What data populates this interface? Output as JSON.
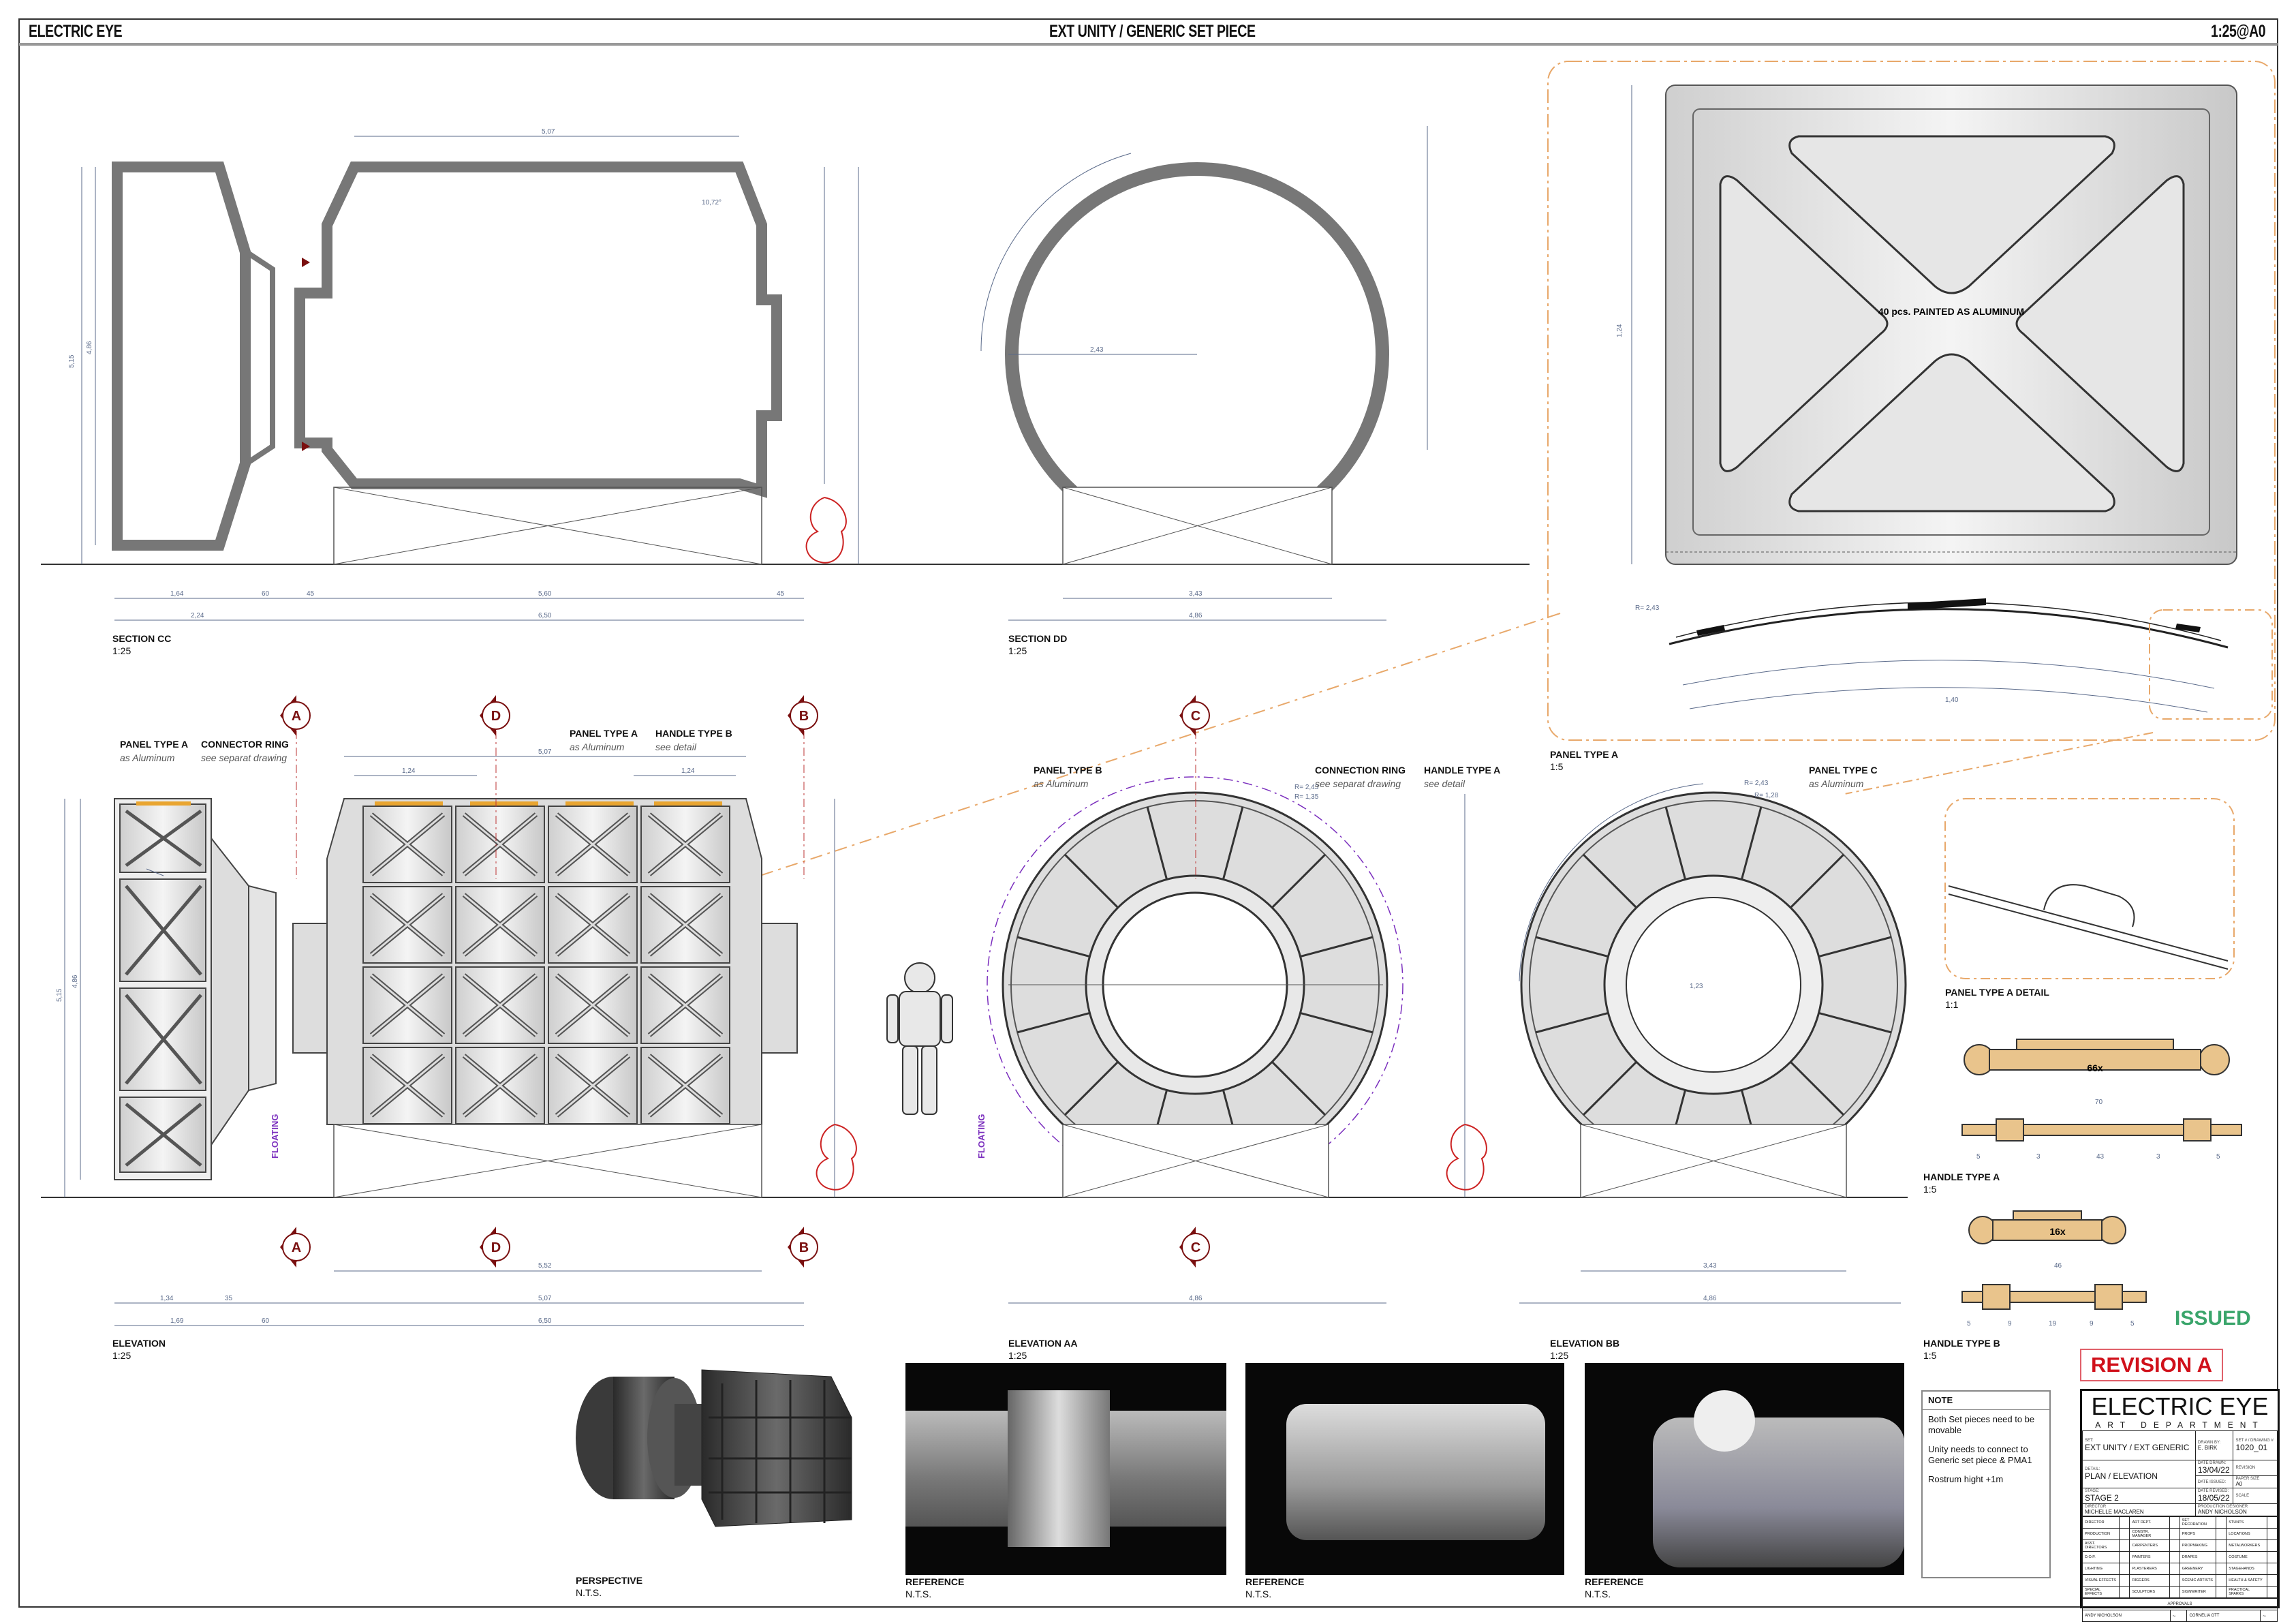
{
  "header": {
    "left": "ELECTRIC EYE",
    "center": "EXT UNITY / GENERIC SET PIECE",
    "right": "1:25@A0"
  },
  "views": {
    "section_cc": {
      "title": "SECTION CC",
      "scale": "1:25"
    },
    "section_dd": {
      "title": "SECTION DD",
      "scale": "1:25"
    },
    "elevation": {
      "title": "ELEVATION",
      "scale": "1:25"
    },
    "elevation_aa": {
      "title": "ELEVATION AA",
      "scale": "1:25"
    },
    "elevation_bb": {
      "title": "ELEVATION BB",
      "scale": "1:25"
    },
    "panel_a": {
      "title": "PANEL TYPE A",
      "scale": "1:5",
      "note": "40 pcs. PAINTED AS ALUMINUM"
    },
    "panel_a_detail": {
      "title": "PANEL TYPE A DETAIL",
      "scale": "1:1"
    },
    "handle_a": {
      "title": "HANDLE TYPE A",
      "scale": "1:5",
      "count": "66x"
    },
    "handle_b": {
      "title": "HANDLE TYPE B",
      "scale": "1:5",
      "count": "16x"
    },
    "perspective": {
      "title": "PERSPECTIVE",
      "scale": "N.T.S."
    },
    "references": [
      {
        "title": "REFERENCE",
        "scale": "N.T.S."
      },
      {
        "title": "REFERENCE",
        "scale": "N.T.S."
      },
      {
        "title": "REFERENCE",
        "scale": "N.T.S."
      }
    ]
  },
  "callouts": {
    "panel_a_1": {
      "title": "PANEL TYPE A",
      "sub": "as Aluminum"
    },
    "connector_ring": {
      "title": "CONNECTOR RING",
      "sub": "see separat drawing"
    },
    "panel_a_2": {
      "title": "PANEL TYPE A",
      "sub": "as Aluminum"
    },
    "handle_b": {
      "title": "HANDLE TYPE B",
      "sub": "see detail"
    },
    "panel_b": {
      "title": "PANEL TYPE B",
      "sub": "as Aluminum"
    },
    "connection_ring": {
      "title": "CONNECTION RING",
      "sub": "see separat drawing"
    },
    "handle_a": {
      "title": "HANDLE TYPE A",
      "sub": "see detail"
    },
    "panel_c": {
      "title": "PANEL TYPE C",
      "sub": "as Aluminum"
    },
    "floating": "FLOATING"
  },
  "markers": [
    "A",
    "D",
    "B",
    "C"
  ],
  "dims": {
    "cc_top": "5,07",
    "cc_a": "1,64",
    "cc_b": "60",
    "cc_c": "45",
    "cc_d": "5,60",
    "cc_e": "45",
    "cc_total_l": "2,24",
    "cc_total": "6,50",
    "cc_h": "5,15",
    "cc_h2": "4,86",
    "cc_angle": "10,72°",
    "dd_r": "2,43",
    "dd_w": "3,43",
    "dd_w2": "4,86",
    "el_top": "5,07",
    "el_p": "1,24",
    "el_p2": "1,24",
    "el_h": "5,15",
    "el_h2": "4,86",
    "el_a": "1,34",
    "el_b": "35",
    "el_c": "5,07",
    "el_total_l": "1,69",
    "el_total_m": "60",
    "el_total": "6,50",
    "el_span": "5,52",
    "aa_w": "4,86",
    "aa_r1": "R= 2,43",
    "aa_r2": "R= 1,35",
    "bb_w": "3,43",
    "bb_w2": "4,86",
    "bb_r1": "R= 2,43",
    "bb_r2": "R= 1,28",
    "bb_i": "1,23",
    "ha_len": "70",
    "ha_seg": [
      "5",
      "3",
      "43",
      "3",
      "5"
    ],
    "hb_len": "46",
    "hb_seg": [
      "5",
      "9",
      "19",
      "9",
      "5"
    ],
    "pa_w": "1,40",
    "pa_r": "R= 2,43",
    "pa_h": "1,24"
  },
  "stamps": {
    "issued": "ISSUED",
    "revision": "REVISION A",
    "issued_color": "#3aa56b",
    "revision_color": "#d0101a"
  },
  "note": {
    "title": "NOTE",
    "lines": [
      "Both Set pieces need to be movable",
      "Unity needs to connect to Generic set piece & PMA1",
      "Rostrum hight +1m"
    ]
  },
  "title_block": {
    "company": "ELECTRIC EYE",
    "dept": "ART DEPARTMENT",
    "set_label": "SET:",
    "set": "EXT UNITY / EXT GENERIC",
    "drawn_by_label": "DRAWN BY:",
    "drawn_by": "E. BIRK",
    "drawing_no_label": "SET # / DRAWING #",
    "drawing_no": "1020_01",
    "detail_label": "DETAIL:",
    "detail": "PLAN / ELEVATION",
    "date_drawn_label": "DATE DRAWN:",
    "date_drawn": "13/04/22",
    "revision_label": "REVISION",
    "date_issued_label": "DATE ISSUED:",
    "paper_size_label": "PAPER SIZE",
    "paper_size": "A0",
    "stage_label": "STAGE:",
    "stage": "STAGE 2",
    "date_revised_label": "DATE REVISED:",
    "date_revised": "18/05/22",
    "scale_label": "SCALE",
    "director_label": "DIRECTOR",
    "director": "MICHELLE MACLAREN",
    "pd_label": "PRODUCTION DESIGNER",
    "pd": "ANDY NICHOLSON",
    "distribution": [
      [
        "DIRECTOR",
        "ART DEPT.",
        "SET DECORATION",
        "STUNTS"
      ],
      [
        "PRODUCTION",
        "CONSTR. MANAGER",
        "PROPS",
        "LOCATIONS"
      ],
      [
        "ASST. DIRECTORS",
        "CARPENTERS",
        "PROPMAKING",
        "METALWORKERS"
      ],
      [
        "D.O.P.",
        "PAINTERS",
        "DRAPES",
        "COSTUME"
      ],
      [
        "LIGHTING",
        "PLASTERERS",
        "GREENERY",
        "STAGEHANDS"
      ],
      [
        "VISUAL EFFECTS",
        "RIGGERS",
        "SCENIC ARTISTS",
        "HEALTH & SAFETY"
      ],
      [
        "SPECIAL EFFECTS",
        "SCULPTORS",
        "SIGNWRITER",
        "PRACTICAL SPARKS"
      ]
    ],
    "approvals_label": "APPROVALS",
    "approver1": "ANDY NICHOLSON",
    "approver2": "CORNELIA OTT"
  },
  "colors": {
    "outline": "#777777",
    "dimension": "#5a6a8a",
    "marker": "#7a1010",
    "detail_frame": "#e8a86a",
    "handle": "#e9c48c",
    "floating": "#7b2fbe"
  }
}
